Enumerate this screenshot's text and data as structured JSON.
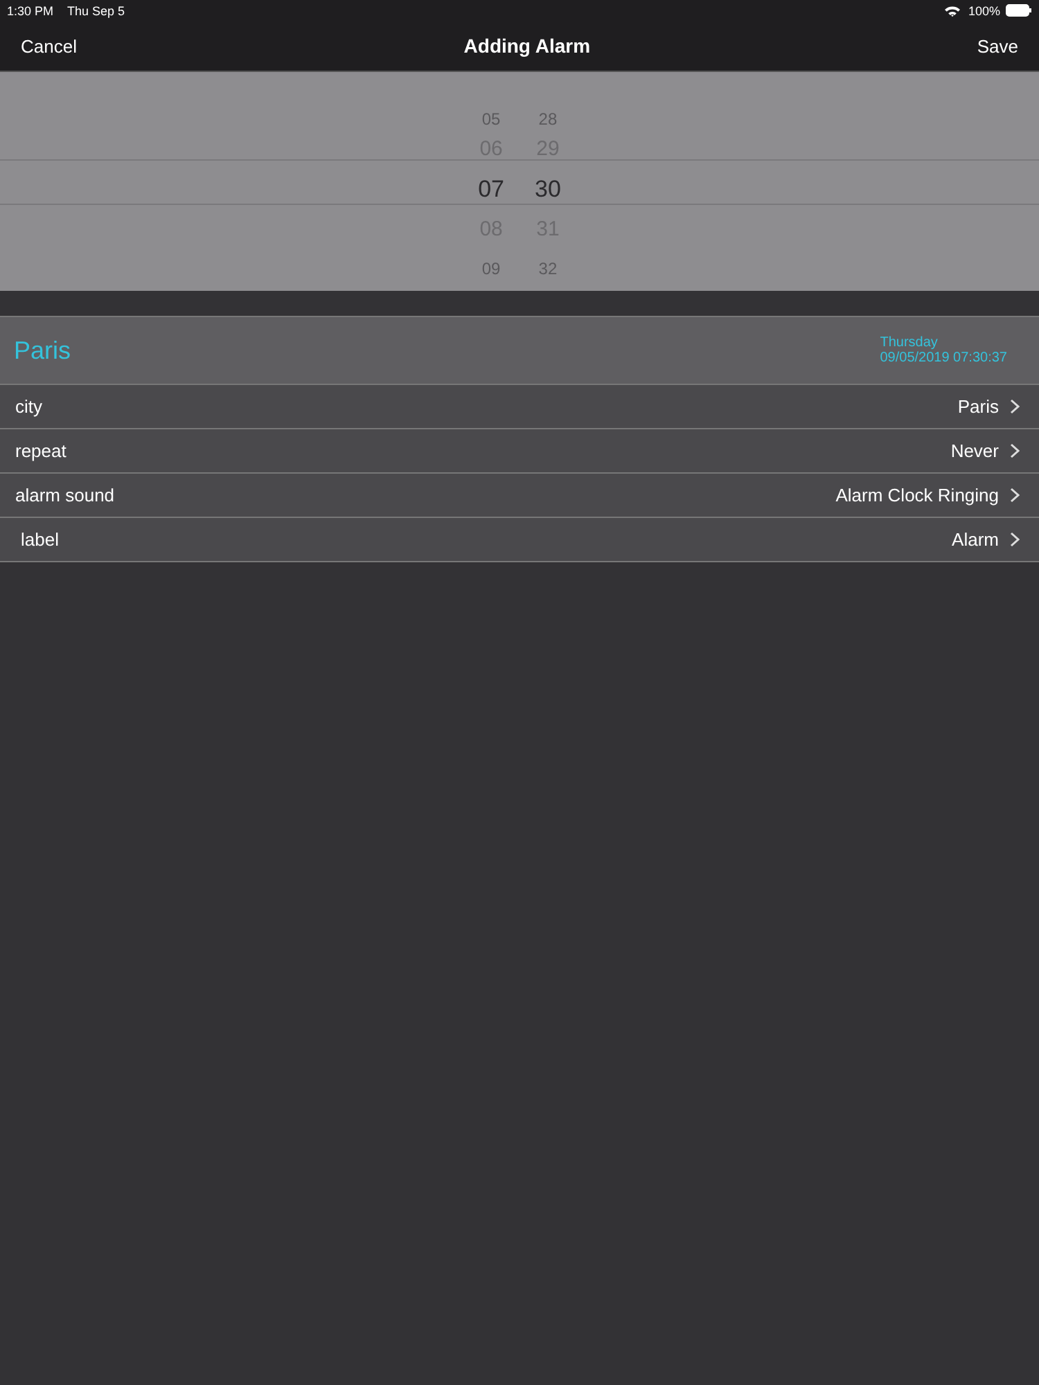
{
  "status_bar": {
    "time": "1:30 PM",
    "date": "Thu Sep 5",
    "battery": "100%"
  },
  "nav": {
    "cancel": "Cancel",
    "title": "Adding Alarm",
    "save": "Save"
  },
  "picker": {
    "columns": [
      {
        "items": [
          {
            "text": "05",
            "selected": false
          },
          {
            "text": "06",
            "selected": false
          },
          {
            "text": "07",
            "selected": true
          },
          {
            "text": "08",
            "selected": false
          },
          {
            "text": "09",
            "selected": false
          }
        ]
      },
      {
        "items": [
          {
            "text": "28",
            "selected": false
          },
          {
            "text": "29",
            "selected": false
          },
          {
            "text": "30",
            "selected": true
          },
          {
            "text": "31",
            "selected": false
          },
          {
            "text": "32",
            "selected": false
          }
        ]
      }
    ]
  },
  "header": {
    "city": "Paris",
    "day": "Thursday",
    "datetime": "09/05/2019 07:30:37"
  },
  "rows": [
    {
      "label": "city",
      "value": "Paris"
    },
    {
      "label": "repeat",
      "value": "Never"
    },
    {
      "label": "alarm sound",
      "value": "Alarm Clock Ringing"
    },
    {
      "label": "label",
      "value": "Alarm"
    }
  ]
}
